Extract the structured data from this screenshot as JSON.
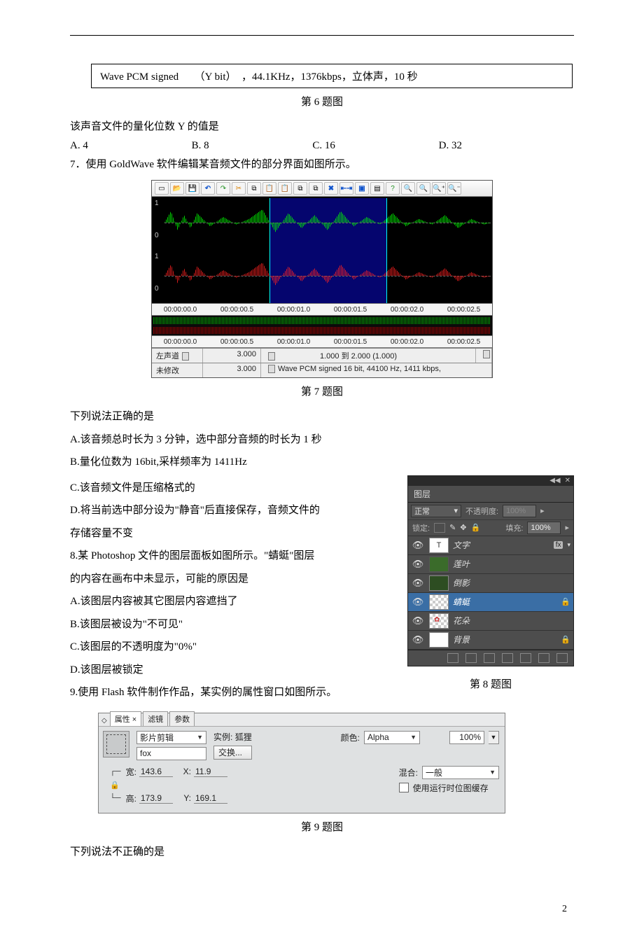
{
  "infoBox": "Wave PCM signed　　（Y bit）　，44.1KHz，1376kbps，立体声，10 秒",
  "cap6": "第 6 题图",
  "q6_stem": "该声音文件的量化位数 Y 的值是",
  "q6_opts": {
    "a": "A. 4",
    "b": "B. 8",
    "c": "C. 16",
    "d": "D. 32"
  },
  "q7_intro": "7．使用 GoldWave 软件编辑某音频文件的部分界面如图所示。",
  "goldwave": {
    "ruler": [
      "00:00:00.0",
      "00:00:00.5",
      "00:00:01.0",
      "00:00:01.5",
      "00:00:02.0",
      "00:00:02.5"
    ],
    "ruler2": [
      "00:00:00.0",
      "00:00:00.5",
      "00:00:01.0",
      "00:00:01.5",
      "00:00:02.0",
      "00:00:02.5"
    ],
    "status1_label": "左声道",
    "status1_num": "3.000",
    "status1_sel": "1.000 到 2.000 (1.000)",
    "status2_label": "未修改",
    "status2_num": "3.000",
    "status2_fmt": "Wave PCM signed 16 bit, 44100 Hz, 1411 kbps,",
    "axis": {
      "one": "1",
      "zero": "0"
    }
  },
  "cap7": "第 7 题图",
  "q7_stem": "下列说法正确的是",
  "q7_a": "A.该音频总时长为 3 分钟，选中部分音频的时长为 1 秒",
  "q7_b": "B.量化位数为 16bit,采样频率为 1411Hz",
  "q7_c": "C.该音频文件是压缩格式的",
  "q7_d1": "D.将当前选中部分设为\"静音\"后直接保存，音频文件的",
  "q7_d2": "存储容量不变",
  "q8_intro1": "8.某 Photoshop 文件的图层面板如图所示。\"蜻蜓\"图层",
  "q8_intro2": "的内容在画布中未显示，可能的原因是",
  "q8_a": "A.该图层内容被其它图层内容遮挡了",
  "q8_b": "B.该图层被设为\"不可见\"",
  "q8_c": "C.该图层的不透明度为\"0%\"",
  "q8_d": "D.该图层被锁定",
  "cap8": "第 8 题图",
  "ps": {
    "tab": "图层",
    "mode": "正常",
    "opacity_lbl": "不透明度:",
    "opacity_val": "100%",
    "lock_lbl": "锁定:",
    "fill_lbl": "填充:",
    "fill_val": "100%",
    "layers": {
      "l0": "文字",
      "l1": "莲叶",
      "l2": "倒影",
      "l3": "蜻蜓",
      "l4": "花朵",
      "l5": "背景"
    },
    "fx": "fx",
    "lock_icon": "🔒"
  },
  "q9_intro": "9.使用 Flash 软件制作作品，某实例的属性窗口如图所示。",
  "flash": {
    "tabs": {
      "props": "属性 ×",
      "filters": "滤镜",
      "params": "参数"
    },
    "type": "影片剪辑",
    "name": "fox",
    "inst_lbl": "实例:",
    "inst_val": "狐狸",
    "swap": "交换...",
    "color_lbl": "颜色:",
    "color_val": "Alpha",
    "pct": "100%",
    "blend_lbl": "混合:",
    "blend_val": "一般",
    "cache": "使用运行时位图缓存",
    "w_lbl": "宽:",
    "w_val": "143.6",
    "x_lbl": "X:",
    "x_val": "11.9",
    "h_lbl": "高:",
    "h_val": "173.9",
    "y_lbl": "Y:",
    "y_val": "169.1",
    "link1": "┌─",
    "link2": "🔒",
    "link3": "└─"
  },
  "cap9": "第 9 题图",
  "q9_stem": "下列说法不正确的是",
  "page_num": "2"
}
